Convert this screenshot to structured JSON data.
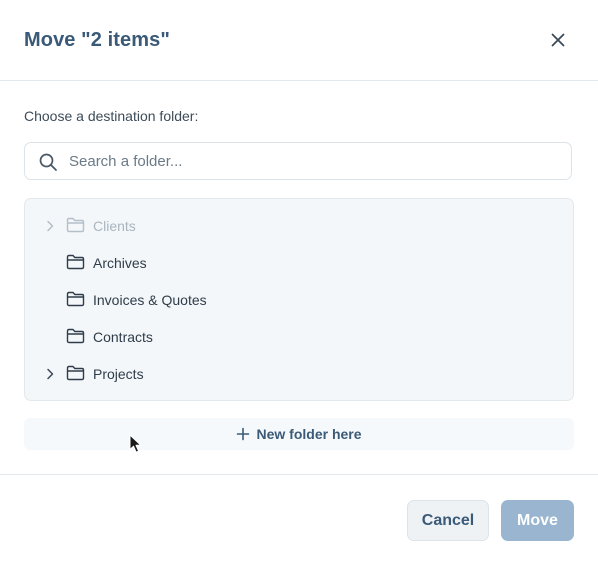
{
  "dialog": {
    "title": "Move \"2 items\"",
    "close_icon": "close-icon",
    "prompt": "Choose a destination folder:"
  },
  "search": {
    "placeholder": "Search a folder...",
    "value": "",
    "icon": "search-icon"
  },
  "tree": {
    "items": [
      {
        "label": "Clients",
        "has_children": true,
        "disabled": true,
        "icon": "folder-icon"
      },
      {
        "label": "Archives",
        "has_children": false,
        "disabled": false,
        "icon": "folder-icon"
      },
      {
        "label": "Invoices & Quotes",
        "has_children": false,
        "disabled": false,
        "icon": "folder-icon"
      },
      {
        "label": "Contracts",
        "has_children": false,
        "disabled": false,
        "icon": "folder-icon"
      },
      {
        "label": "Projects",
        "has_children": true,
        "disabled": false,
        "icon": "folder-icon"
      }
    ]
  },
  "new_folder": {
    "label": "New folder here",
    "icon": "plus-icon"
  },
  "footer": {
    "cancel_label": "Cancel",
    "move_label": "Move",
    "move_disabled": true
  },
  "colors": {
    "title": "#3a5a78",
    "primary_disabled": "#99b5cf",
    "tree_bg": "#f4f7f9",
    "border": "#e3e8ec"
  }
}
